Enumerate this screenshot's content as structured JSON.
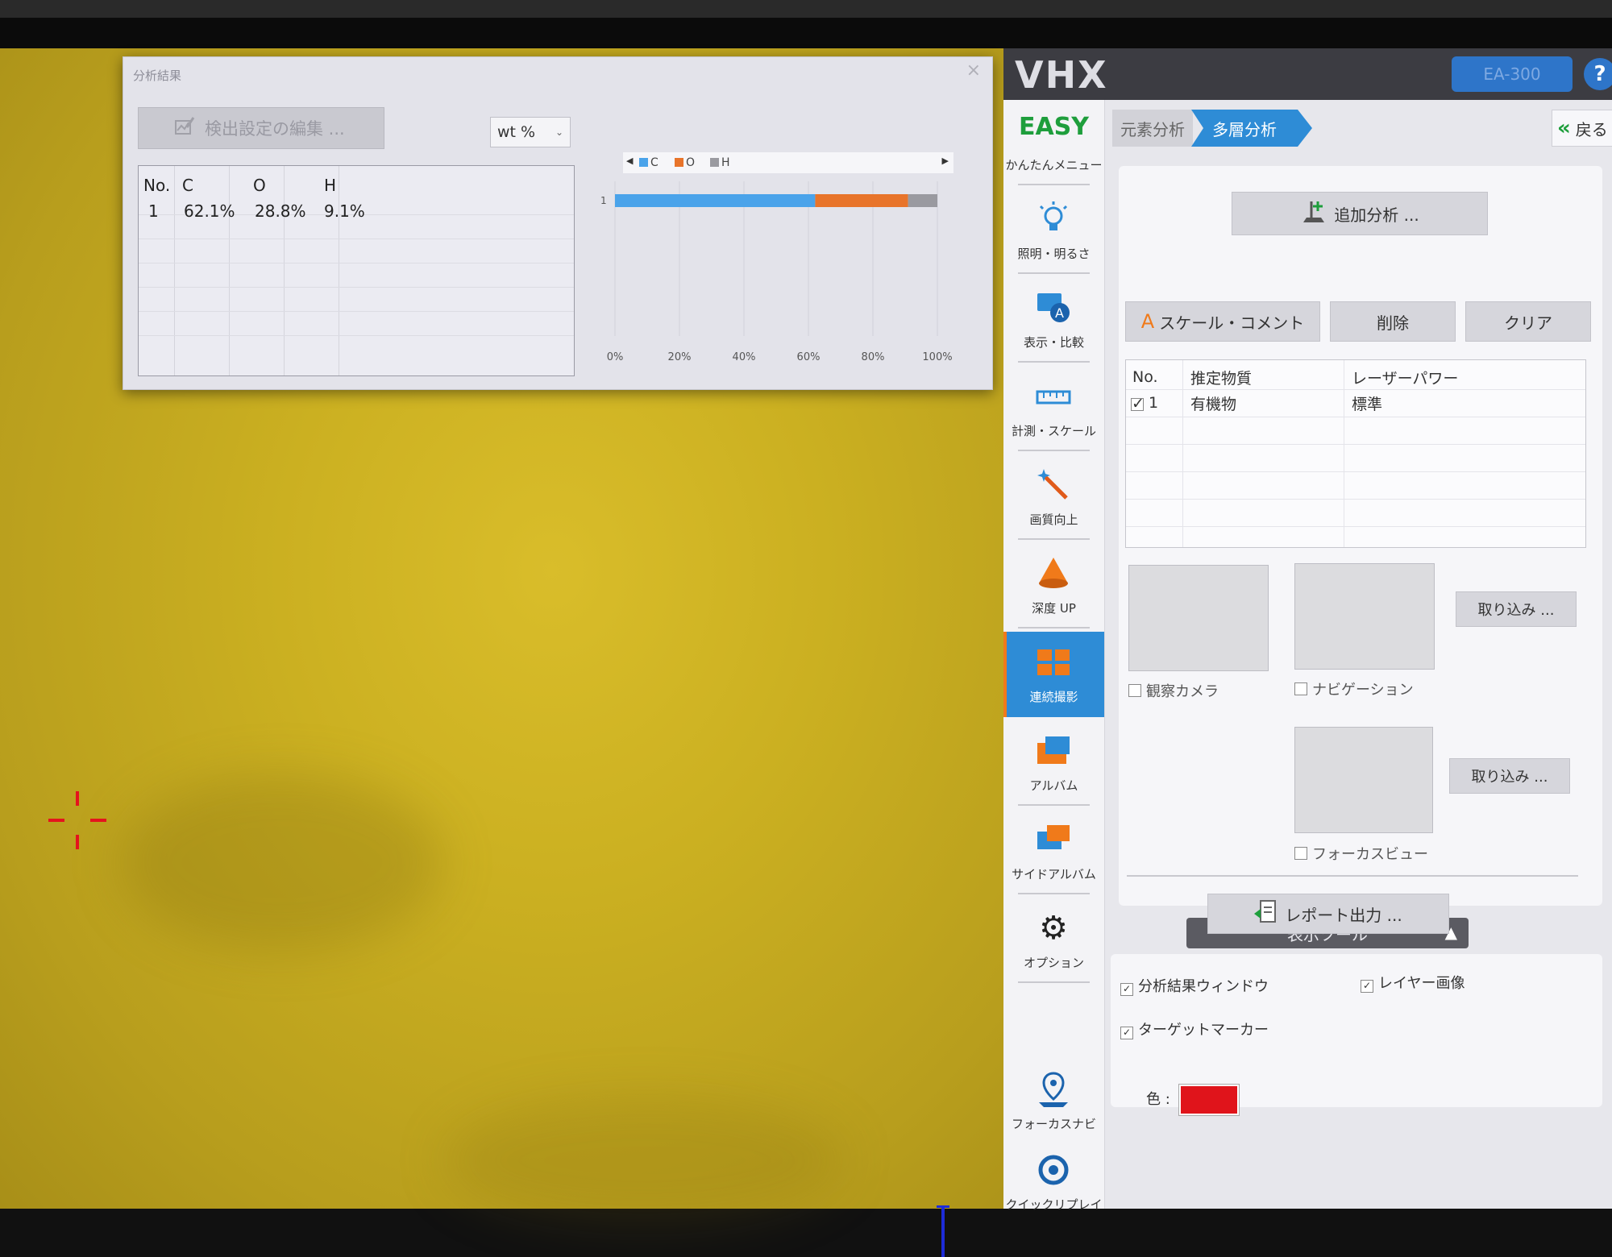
{
  "result_window": {
    "title": "分析結果",
    "close": "×",
    "edit_button": "検出設定の編集 ...",
    "unit": "wt %",
    "table": {
      "headers": [
        "No.",
        "C",
        "O",
        "H"
      ],
      "rows": [
        [
          "1",
          "62.1%",
          "28.8%",
          "9.1%"
        ]
      ]
    }
  },
  "chart_data": {
    "type": "bar",
    "orientation": "horizontal",
    "stacked": true,
    "categories": [
      "1"
    ],
    "series": [
      {
        "name": "C",
        "values": [
          62.1
        ],
        "color": "#4aa3ea"
      },
      {
        "name": "O",
        "values": [
          28.8
        ],
        "color": "#e8742a"
      },
      {
        "name": "H",
        "values": [
          9.1
        ],
        "color": "#9a9aa0"
      }
    ],
    "xlim": [
      0,
      100
    ],
    "xticks": [
      "0%",
      "20%",
      "40%",
      "60%",
      "80%",
      "100%"
    ],
    "legend_position": "top",
    "grid": true
  },
  "panel": {
    "logo": "VHX",
    "ea_button": "EA-300",
    "help": "?",
    "sidebar": [
      {
        "label": "かんたんメニュー",
        "icon": "easy-icon",
        "text": "EASY"
      },
      {
        "label": "照明・明るさ",
        "icon": "lightbulb-icon"
      },
      {
        "label": "表示・比較",
        "icon": "display-compare-icon"
      },
      {
        "label": "計測・スケール",
        "icon": "ruler-icon"
      },
      {
        "label": "画質向上",
        "icon": "magic-wand-icon"
      },
      {
        "label": "深度 UP",
        "icon": "depth-cone-icon"
      },
      {
        "label": "連続撮影",
        "icon": "tiles-icon"
      },
      {
        "label": "アルバム",
        "icon": "album-folder-icon"
      },
      {
        "label": "サイドアルバム",
        "icon": "side-album-icon"
      },
      {
        "label": "オプション",
        "icon": "gear-icon"
      },
      {
        "label": "フォーカスナビ",
        "icon": "focus-navi-icon"
      },
      {
        "label": "クイックリプレイ",
        "icon": "quick-replay-icon"
      }
    ],
    "tabs": {
      "elemental": "元素分析",
      "multilayer": "多層分析"
    },
    "back": "戻る",
    "add_analysis": "追加分析 ...",
    "scale_comment": "スケール・コメント",
    "delete": "削除",
    "clear": "クリア",
    "layer_table": {
      "headers": [
        "No.",
        "推定物質",
        "レーザーパワー"
      ],
      "rows": [
        {
          "no": "1",
          "material": "有機物",
          "power": "標準",
          "checked": true
        }
      ]
    },
    "thumbs": {
      "camera": "観察カメラ",
      "navigation": "ナビゲーション",
      "capture": "取り込み ...",
      "focus_view": "フォーカスビュー"
    },
    "report": "レポート出力 ...",
    "display_tools": {
      "header": "表示ツール",
      "result_window": "分析結果ウィンドウ",
      "layer_image": "レイヤー画像",
      "target_marker": "ターゲットマーカー",
      "color_label": "色 :",
      "marker_color": "#e0141b"
    }
  }
}
